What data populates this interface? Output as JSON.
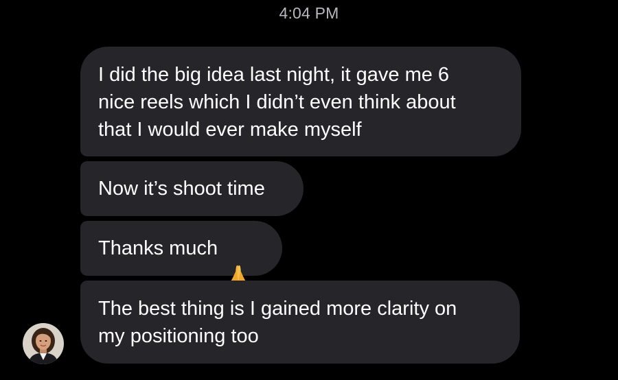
{
  "timestamp": "4:04 PM",
  "messages": [
    {
      "text": "I did the big idea last night, it gave me 6\nnice reels which I didn’t even think about\nthat I would ever make myself"
    },
    {
      "text": "Now it’s shoot time"
    },
    {
      "text": "Thanks much",
      "emoji": "folded-hands-icon"
    },
    {
      "text": "The best thing is I gained more clarity on\nmy positioning too"
    }
  ],
  "colors": {
    "background": "#000000",
    "bubble": "#26262a",
    "timestamp": "#b8b8bd",
    "text": "#ffffff"
  }
}
